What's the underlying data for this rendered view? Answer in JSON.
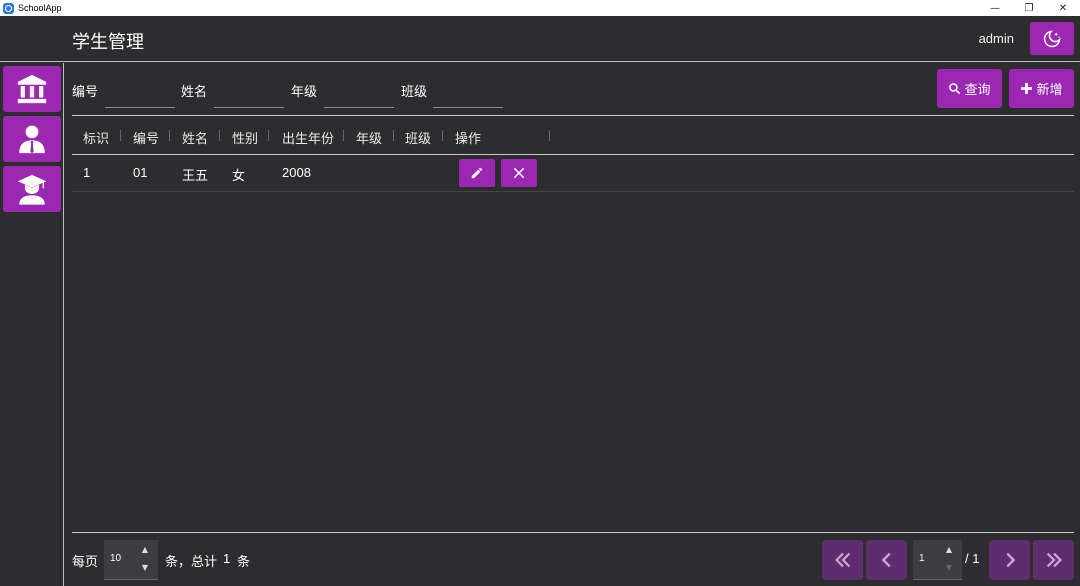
{
  "window": {
    "title": "SchoolApp",
    "controls": {
      "minimize": "—",
      "restore": "❐",
      "close": "✕"
    }
  },
  "header": {
    "title": "学生管理",
    "user": "admin"
  },
  "sidebar": {
    "items": [
      {
        "icon": "institution-icon"
      },
      {
        "icon": "teacher-icon"
      },
      {
        "icon": "graduate-icon"
      }
    ]
  },
  "search": {
    "fields": [
      {
        "label": "编号",
        "value": ""
      },
      {
        "label": "姓名",
        "value": ""
      },
      {
        "label": "年级",
        "value": ""
      },
      {
        "label": "班级",
        "value": ""
      }
    ],
    "query_label": "查询",
    "add_label": "新增"
  },
  "table": {
    "columns": [
      "标识",
      "编号",
      "姓名",
      "性别",
      "出生年份",
      "年级",
      "班级",
      "操作"
    ],
    "rows": [
      {
        "id": "1",
        "code": "01",
        "name": "王五",
        "gender": "女",
        "birth_year": "2008",
        "grade": "",
        "class": ""
      }
    ]
  },
  "footer": {
    "per_page_label": "每页",
    "page_size": "10",
    "total_prefix": "条，总计",
    "total": "1",
    "total_suffix": "条",
    "current_page": "1",
    "total_pages": "/ 1"
  },
  "colors": {
    "accent": "#9c27b0",
    "accent_disabled": "#5d2d6e",
    "background": "#2d2d30"
  }
}
